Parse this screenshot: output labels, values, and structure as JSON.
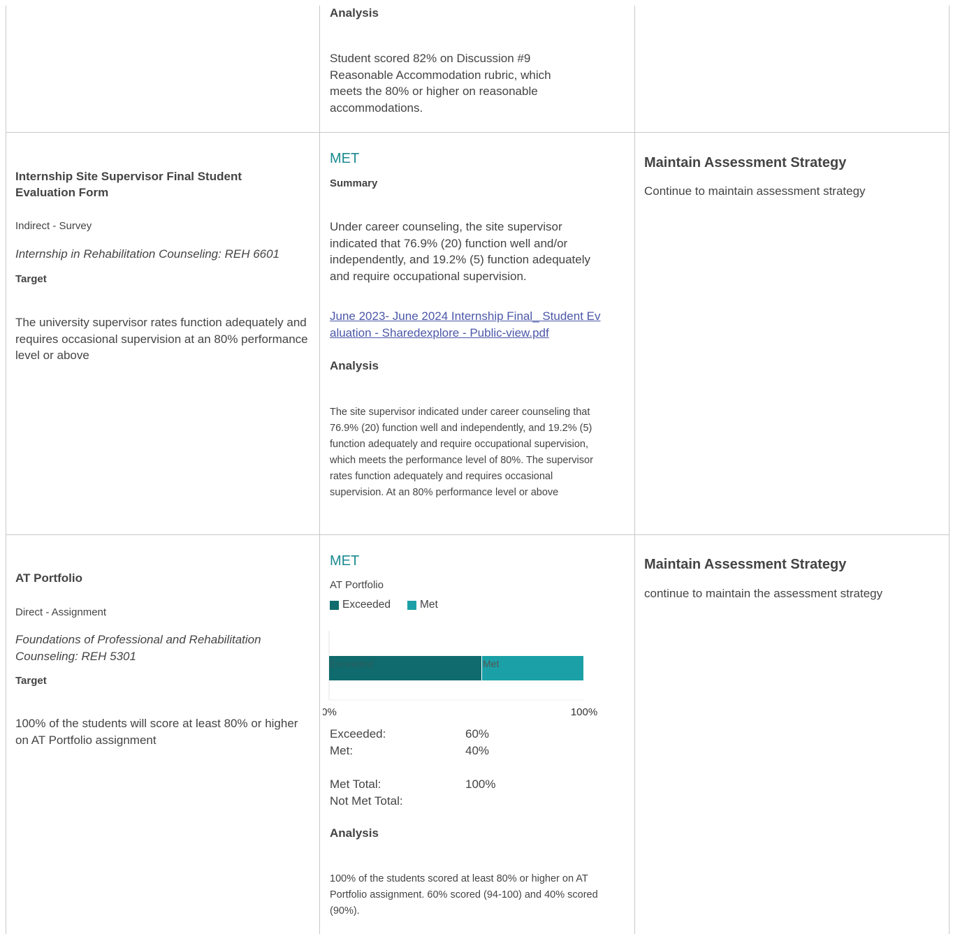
{
  "colors": {
    "met": "#1a8a8f",
    "exceeded_bar": "#0f6b6d",
    "met_bar": "#1aa0a6",
    "link": "#4b57a8",
    "border": "#c8c8c8",
    "text": "#444444"
  },
  "row1": {
    "analysis_heading": "Analysis",
    "analysis_text": "Student scored 82% on Discussion #9 Reasonable Accommodation rubric, which meets the 80% or higher on reasonable accommodations."
  },
  "row2": {
    "measure_title": "Internship Site Supervisor Final Student Evaluation Form",
    "measure_type": "Indirect - Survey",
    "course": "Internship in Rehabilitation Counseling: REH 6601",
    "target_heading": "Target",
    "target_text": "The university supervisor rates function adequately and requires occasional supervision at an 80% performance level or above",
    "status": "MET",
    "summary_heading": "Summary",
    "summary_text": "Under career counseling, the site supervisor indicated that 76.9% (20) function well and/or independently, and 19.2% (5) function adequately and require occupational supervision.",
    "attachment_link": "June 2023- June 2024 Internship Final_ Student Evaluation - Sharedexplore - Public-view.pdf",
    "analysis_heading": "Analysis",
    "analysis_text": "The site supervisor indicated under career counseling that 76.9% (20) function well and independently, and 19.2% (5) function adequately and require occupational supervision, which meets the performance level of 80%. The supervisor rates function adequately and requires occasional supervision. At an 80% performance level or above",
    "action_heading": "Maintain Assessment Strategy",
    "action_text": "Continue to maintain assessment strategy"
  },
  "row3": {
    "measure_title": "AT Portfolio",
    "measure_type": "Direct - Assignment",
    "course": "Foundations of Professional and Rehabilitation Counseling: REH 5301",
    "target_heading": "Target",
    "target_text": "100% of the students will score at least 80% or higher on AT  Portfolio assignment",
    "status": "MET",
    "chart_title": "AT Portfolio",
    "stats": {
      "exceeded_label": "Exceeded:",
      "exceeded_value": "60%",
      "met_label": "Met:",
      "met_value": "40%",
      "met_total_label": "Met Total:",
      "met_total_value": "100%",
      "not_met_total_label": "Not Met Total:",
      "not_met_total_value": ""
    },
    "analysis_heading": "Analysis",
    "analysis_text": "100% of the students scored at least 80% or higher on AT Portfolio assignment. 60% scored (94-100) and 40% scored (90%).",
    "action_heading": "Maintain Assessment Strategy",
    "action_text": "continue to maintain the assessment strategy"
  },
  "chart_data": {
    "type": "bar",
    "orientation": "horizontal-stacked",
    "title": "AT Portfolio",
    "legend_position": "top-left",
    "series": [
      {
        "name": "Exceeded",
        "values": [
          60
        ]
      },
      {
        "name": "Met",
        "values": [
          40
        ]
      }
    ],
    "categories": [
      ""
    ],
    "xlim": [
      0,
      100
    ],
    "x_tick_labels": [
      "0%",
      "100%"
    ],
    "grid": false
  }
}
